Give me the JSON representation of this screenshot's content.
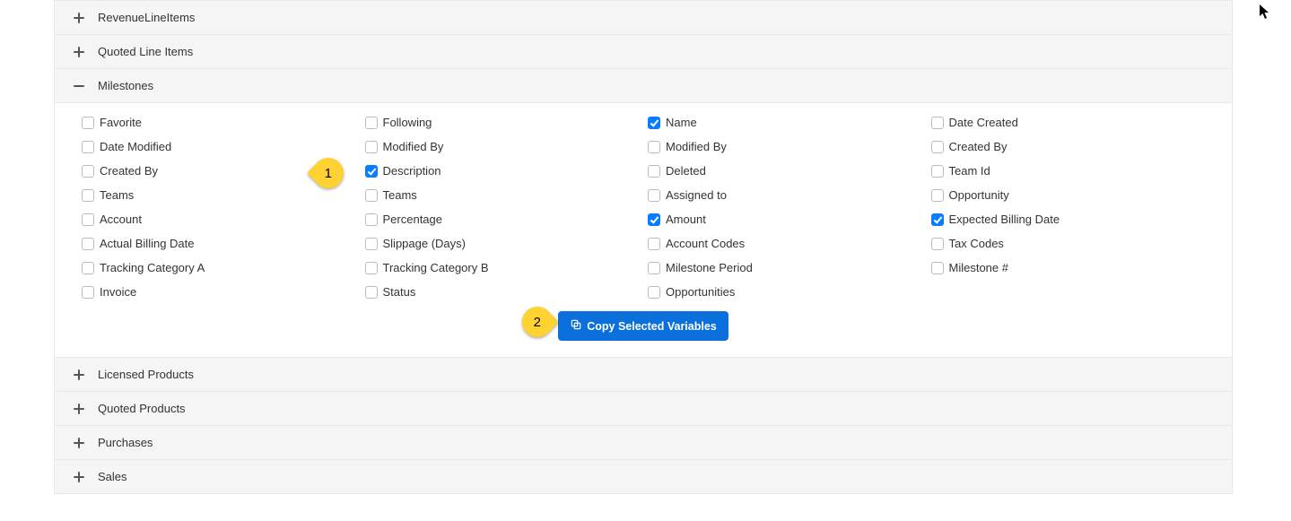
{
  "sections": {
    "revenue": {
      "label": "RevenueLineItems"
    },
    "quotedLines": {
      "label": "Quoted Line Items"
    },
    "milestones": {
      "label": "Milestones"
    },
    "licensed": {
      "label": "Licensed Products"
    },
    "quotedProducts": {
      "label": "Quoted Products"
    },
    "purchases": {
      "label": "Purchases"
    },
    "sales": {
      "label": "Sales"
    }
  },
  "fields": {
    "favorite": "Favorite",
    "following": "Following",
    "name": "Name",
    "dateCreated": "Date Created",
    "dateModified": "Date Modified",
    "modifiedBy1": "Modified By",
    "modifiedBy2": "Modified By",
    "createdBy1": "Created By",
    "createdBy2": "Created By",
    "description": "Description",
    "deleted": "Deleted",
    "teamId": "Team Id",
    "teams1": "Teams",
    "teams2": "Teams",
    "assignedTo": "Assigned to",
    "opportunity": "Opportunity",
    "account": "Account",
    "percentage": "Percentage",
    "amount": "Amount",
    "expectedBilling": "Expected Billing Date",
    "actualBilling": "Actual Billing Date",
    "slippage": "Slippage (Days)",
    "accountCodes": "Account Codes",
    "taxCodes": "Tax Codes",
    "trackingA": "Tracking Category A",
    "trackingB": "Tracking Category B",
    "milestonePeriod": "Milestone Period",
    "milestoneNum": "Milestone #",
    "invoice": "Invoice",
    "status": "Status",
    "opportunities": "Opportunities"
  },
  "button": {
    "copy": "Copy Selected Variables"
  },
  "callouts": {
    "one": "1",
    "two": "2"
  }
}
